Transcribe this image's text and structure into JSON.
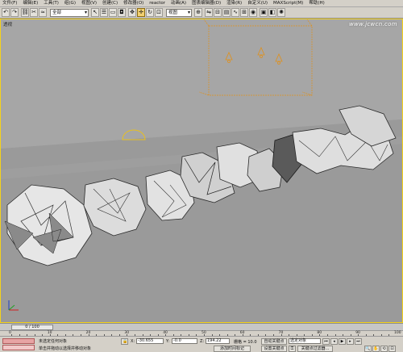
{
  "menu": [
    "文件(F)",
    "编辑(E)",
    "工具(T)",
    "组(G)",
    "视图(V)",
    "创建(C)",
    "修改器(O)",
    "reactor",
    "动画(A)",
    "图表编辑器(D)",
    "渲染(R)",
    "自定义(U)",
    "MAXScript(M)",
    "帮助(H)"
  ],
  "toolbar": {
    "selection_filter": "全部",
    "coord_system": "视图"
  },
  "viewport": {
    "label": "透视",
    "watermark": "www.jcwcn.com"
  },
  "timeline": {
    "frame_display": "0 / 100",
    "ticks": [
      "0",
      "10",
      "20",
      "30",
      "40",
      "50",
      "60",
      "70",
      "80",
      "90",
      "100"
    ]
  },
  "status": {
    "selection_status": "未选定任何对象",
    "prompt": "单击并拖动以选择并移动对象",
    "x_label": "X:",
    "x_value": "-30.655",
    "y_label": "Y:",
    "y_value": "-0.0",
    "z_label": "Z:",
    "z_value": "194.22",
    "grid": "栅格 = 10.0",
    "auto_key": "自动关键点",
    "selected_object": "选定对象",
    "set_key": "设置关键点",
    "key_filters": "关键点过滤器...",
    "add_time_tag": "添加时间标记"
  }
}
